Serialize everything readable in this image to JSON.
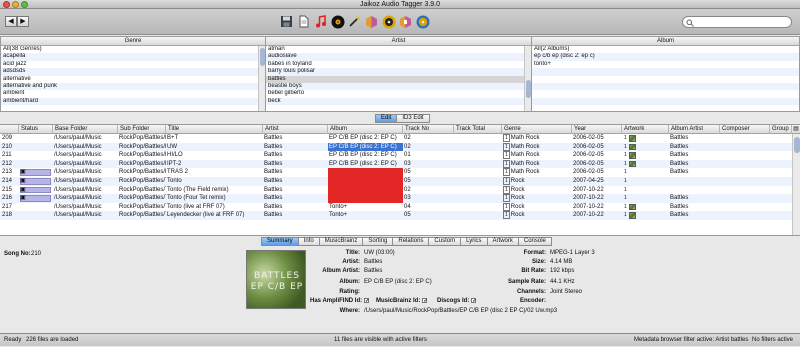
{
  "window": {
    "title": "Jaikoz Audio Tagger 3.9.0"
  },
  "toolbar": {
    "back": "◀",
    "forward": "▶",
    "icons": [
      "save-icon",
      "document-icon",
      "music-note-icon",
      "vinyl-record-icon",
      "wand-icon",
      "musicbrainz-icon",
      "cd-icon",
      "discogs-icon",
      "cd-disc-icon"
    ]
  },
  "browser": {
    "genre": {
      "header": "Genre",
      "items": [
        "All(38 Genres)",
        "acapella",
        "acid jazz",
        "adsdsds",
        "alternative",
        "alternative and punk",
        "ambient",
        "ambient/hard"
      ]
    },
    "artist": {
      "header": "Artist",
      "items": [
        "atman",
        "audioslave",
        "babes in toyland",
        "barry louis polisar",
        "battles",
        "beastie boys",
        "bebel gilberto",
        "beck"
      ]
    },
    "album": {
      "header": "Album",
      "items": [
        "All(2 Albums)",
        "ep c/b ep (disc 2: ep c)",
        "tonto+"
      ]
    }
  },
  "edit_tabs": [
    "Edit",
    "ID3 Edit"
  ],
  "table": {
    "headers": [
      "Status",
      "Base Folder",
      "Sub Folder",
      "Title",
      "Artist",
      "Album",
      "Track No",
      "Track Total",
      "Genre",
      "Year",
      "Artwork",
      "Album Artist",
      "Composer",
      "Group"
    ],
    "rows": [
      {
        "num": "209",
        "base": "/Users/paul/Music",
        "sub": "RockPop/Battles/E",
        "title": "B+T",
        "artist": "Battles",
        "album": "EP C/B EP (disc 2: EP C)",
        "track": "02",
        "genre": "Math Rock",
        "year": "2006-02-05",
        "albumartist": "Battles"
      },
      {
        "num": "210",
        "base": "/Users/paul/Music",
        "sub": "RockPop/Battles/E",
        "title": "UW",
        "artist": "Battles",
        "album": "EP C/B EP (disc 2: EP C)",
        "track": "02",
        "genre": "Math Rock",
        "year": "2006-02-05",
        "albumartist": "Battles"
      },
      {
        "num": "211",
        "base": "/Users/paul/Music",
        "sub": "RockPop/Battles/E",
        "title": "HI/LO",
        "artist": "Battles",
        "album": "EP C/B EP (disc 2: EP C)",
        "track": "01",
        "genre": "Math Rock",
        "year": "2006-02-05",
        "albumartist": "Battles"
      },
      {
        "num": "212",
        "base": "/Users/paul/Music",
        "sub": "RockPop/Battles/E",
        "title": "IPT-2",
        "artist": "Battles",
        "album": "EP C/B EP (disc 2: EP C)",
        "track": "03",
        "genre": "Math Rock",
        "year": "2006-02-05",
        "albumartist": "Battles"
      },
      {
        "num": "213",
        "base": "/Users/paul/Music",
        "sub": "RockPop/Battles/E",
        "title": "TRAS 2",
        "artist": "Battles",
        "album": "",
        "track": "05",
        "genre": "Math Rock",
        "year": "2006-02-05",
        "albumartist": "Battles"
      },
      {
        "num": "214",
        "base": "/Users/paul/Music",
        "sub": "RockPop/Battles/T",
        "title": "Tonto",
        "artist": "Battles",
        "album": "",
        "track": "05",
        "genre": "Rock",
        "year": "2007-04-25",
        "albumartist": ""
      },
      {
        "num": "215",
        "base": "/Users/paul/Music",
        "sub": "RockPop/Battles/T",
        "title": "Tonto (The Field remix)",
        "artist": "Battles",
        "album": "",
        "track": "02",
        "genre": "Rock",
        "year": "2007-10-22",
        "albumartist": ""
      },
      {
        "num": "216",
        "base": "/Users/paul/Music",
        "sub": "RockPop/Battles/T",
        "title": "Tonto (Four Tet remix)",
        "artist": "Battles",
        "album": "",
        "track": "03",
        "genre": "Rock",
        "year": "2007-10-22",
        "albumartist": "Battles"
      },
      {
        "num": "217",
        "base": "/Users/paul/Music",
        "sub": "RockPop/Battles/T",
        "title": "Tonto (live at FRF 07)",
        "artist": "Battles",
        "album": "Tonto+",
        "track": "04",
        "genre": "Rock",
        "year": "2007-10-22",
        "albumartist": "Battles"
      },
      {
        "num": "218",
        "base": "/Users/paul/Music",
        "sub": "RockPop/Battles/T",
        "title": "Leyendecker (live at FRF 07)",
        "artist": "Battles",
        "album": "Tonto+",
        "track": "05",
        "genre": "Rock",
        "year": "2007-10-22",
        "albumartist": "Battles"
      }
    ]
  },
  "detail_tabs": [
    "Summary",
    "Info",
    "MusicBrainz",
    "Sorting",
    "Relations",
    "Custom",
    "Lyrics",
    "Artwork",
    "Console"
  ],
  "summary": {
    "song_no_label": "Song No:",
    "song_no": "210",
    "cover_line1": "BATTLES",
    "cover_line2": "EP C/B EP",
    "title_label": "Title:",
    "title": "UW (03:00)",
    "album_artist_label": "Album Artist:",
    "album_artist": "Battles",
    "artist_label": "Artist:",
    "artist": "Battles",
    "album_label": "Album:",
    "album": "EP C/B EP (disc 2: EP C)",
    "rating_label": "Rating:",
    "amplifind_label": "Has AmpliFIND Id:",
    "musicbrainz_label": "MusicBrainz Id:",
    "discogs_label": "Discogs Id:",
    "where_label": "Where:",
    "where": "/Users/paul/Music/RockPop/Battles/EP C/B EP (disc 2 EP C)/02 Uw.mp3",
    "format_label": "Format:",
    "format": "MPEG-1 Layer 3",
    "size_label": "Size:",
    "size": "4.14 MB",
    "bitrate_label": "Bit Rate:",
    "bitrate": "192 kbps",
    "samplerate_label": "Sample Rate:",
    "samplerate": "44.1 KHz",
    "channels_label": "Channels:",
    "channels": "Joint Stereo",
    "encoder_label": "Encoder:",
    "encoder": ""
  },
  "statusbar": {
    "left": "Ready",
    "count": "226 files are loaded",
    "center": "11 files are visible with active filters",
    "right1": "Metadata browser filter active: Artist battles",
    "right2": "No filters active"
  }
}
